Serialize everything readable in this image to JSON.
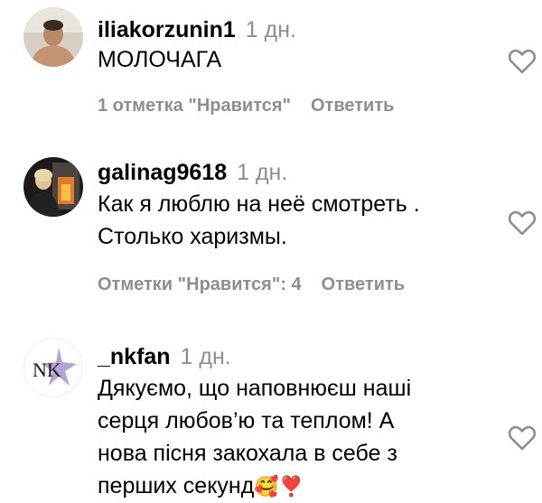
{
  "comments": [
    {
      "username": "iliakorzunin1",
      "time": "1 дн.",
      "lines": [
        "МОЛОЧАГА"
      ],
      "likes": "1 отметка \"Нравится\"",
      "reply": "Ответить"
    },
    {
      "username": "galinag9618",
      "time": "1 дн.",
      "lines": [
        "Как я люблю на неё смотреть .",
        "Столько харизмы."
      ],
      "likes": "Отметки \"Нравится\": 4",
      "reply": "Ответить"
    },
    {
      "username": "_nkfan",
      "time": "1 дн.",
      "lines": [
        "Дякуємо, що наповнюєш наші",
        "серця любов’ю та теплом! А",
        "нова пісня закохала в себе з",
        "перших секунд"
      ],
      "emoji": "🥰❣️",
      "avatar_text": "NK",
      "reply": ""
    }
  ],
  "icons": {
    "like": "heart-outline-icon"
  },
  "colors": {
    "text": "#000000",
    "secondary": "#8e8e8e",
    "background": "#ffffff"
  }
}
